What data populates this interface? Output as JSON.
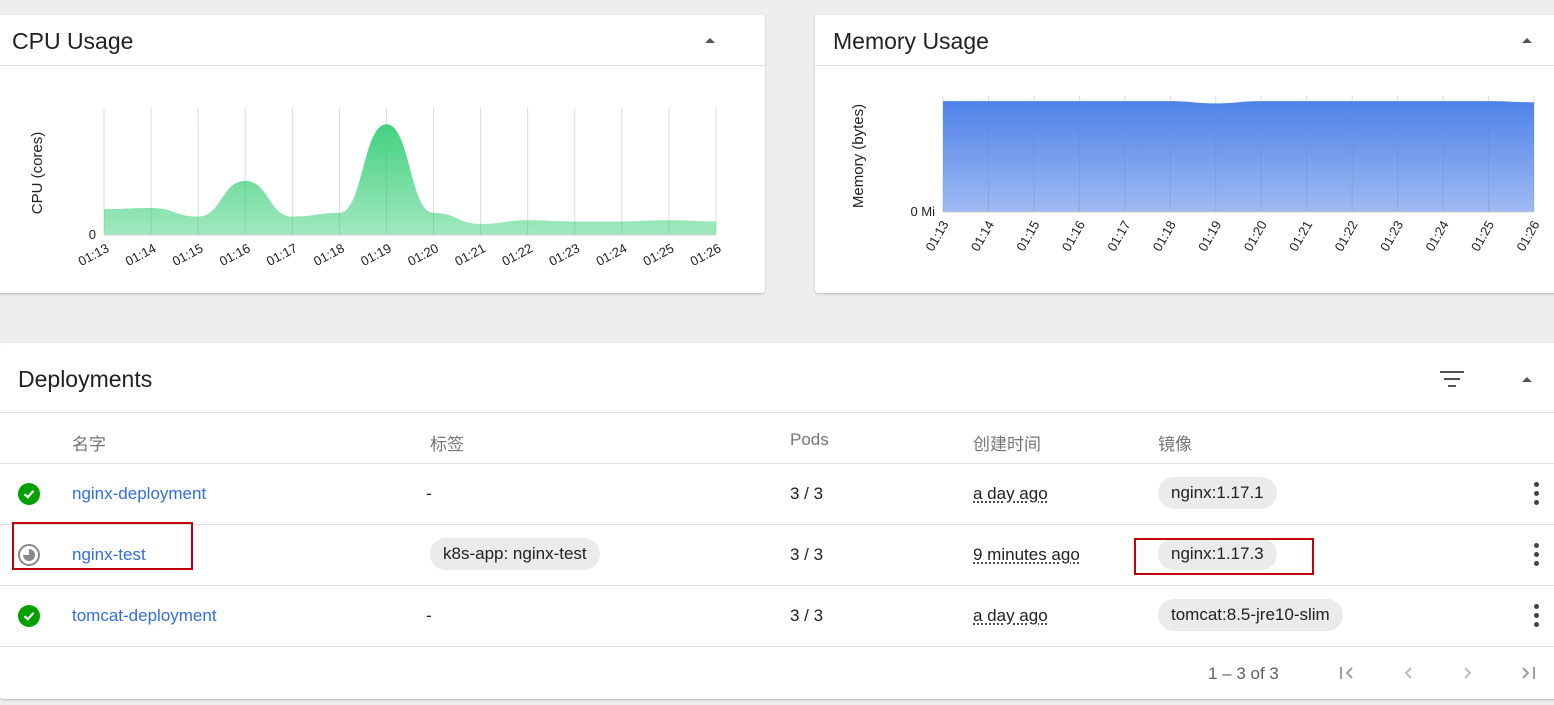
{
  "cpu_chart": {
    "title": "CPU Usage",
    "ylabel": "CPU (cores)",
    "ytick": "0",
    "x": [
      "01:13",
      "01:14",
      "01:15",
      "01:16",
      "01:17",
      "01:18",
      "01:19",
      "01:20",
      "01:21",
      "01:22",
      "01:23",
      "01:24",
      "01:25",
      "01:26"
    ],
    "color": "#2ecc71"
  },
  "memory_chart": {
    "title": "Memory Usage",
    "ylabel": "Memory (bytes)",
    "ytick": "0 Mi",
    "x": [
      "01:13",
      "01:14",
      "01:15",
      "01:16",
      "01:17",
      "01:18",
      "01:19",
      "01:20",
      "01:21",
      "01:22",
      "01:23",
      "01:24",
      "01:25",
      "01:26"
    ],
    "color": "#4f82e8"
  },
  "chart_data": [
    {
      "type": "area",
      "title": "CPU Usage",
      "ylabel": "CPU (cores)",
      "x": [
        "01:13",
        "01:14",
        "01:15",
        "01:16",
        "01:17",
        "01:18",
        "01:19",
        "01:20",
        "01:21",
        "01:22",
        "01:23",
        "01:24",
        "01:25",
        "01:26"
      ],
      "y_relative": [
        0.21,
        0.22,
        0.15,
        0.44,
        0.15,
        0.18,
        0.9,
        0.18,
        0.09,
        0.12,
        0.11,
        0.11,
        0.12,
        0.11
      ],
      "ytick_labels": [
        "0"
      ],
      "grid": true
    },
    {
      "type": "area",
      "title": "Memory Usage",
      "ylabel": "Memory (bytes)",
      "x": [
        "01:13",
        "01:14",
        "01:15",
        "01:16",
        "01:17",
        "01:18",
        "01:19",
        "01:20",
        "01:21",
        "01:22",
        "01:23",
        "01:24",
        "01:25",
        "01:26"
      ],
      "y_relative": [
        0.99,
        0.99,
        0.99,
        0.99,
        0.99,
        0.99,
        0.97,
        0.99,
        0.99,
        0.99,
        0.99,
        0.99,
        0.99,
        0.98
      ],
      "ytick_labels": [
        "0 Mi"
      ],
      "grid": true
    }
  ],
  "deployments": {
    "title": "Deployments",
    "columns": [
      "名字",
      "标签",
      "Pods",
      "创建时间",
      "镜像"
    ],
    "rows": [
      {
        "status": "running",
        "name": "nginx-deployment",
        "labels": "-",
        "pods": "3 / 3",
        "created": "a day ago",
        "image": "nginx:1.17.1"
      },
      {
        "status": "pending",
        "name": "nginx-test",
        "labels": "k8s-app: nginx-test",
        "pods": "3 / 3",
        "created": "9 minutes ago",
        "image": "nginx:1.17.3"
      },
      {
        "status": "running",
        "name": "tomcat-deployment",
        "labels": "-",
        "pods": "3 / 3",
        "created": "a day ago",
        "image": "tomcat:8.5-jre10-slim"
      }
    ],
    "pagination": "1 – 3 of 3"
  },
  "colors": {
    "link": "#326de6",
    "success": "#00a100",
    "highlight": "#c4000a"
  }
}
